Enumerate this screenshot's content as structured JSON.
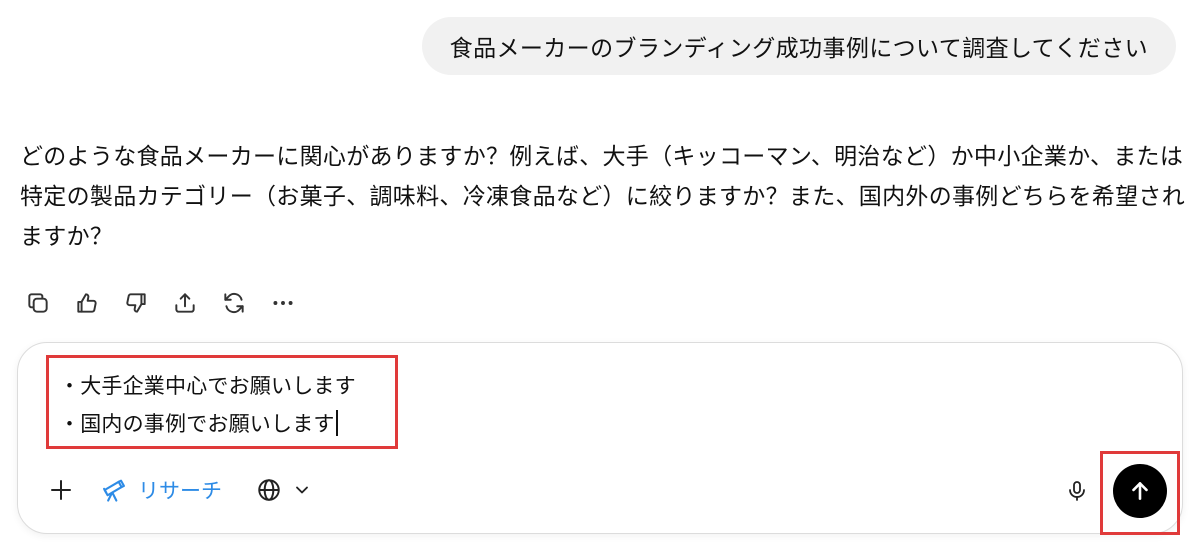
{
  "conversation": {
    "user_message": "食品メーカーのブランディング成功事例について調査してください",
    "assistant_message": "どのような食品メーカーに関心がありますか？例えば、大手（キッコーマン、明治など）か中小企業か、または特定の製品カテゴリー（お菓子、調味料、冷凍食品など）に絞りますか？また、国内外の事例どちらを希望されますか？"
  },
  "message_actions": [
    {
      "icon": "copy-icon"
    },
    {
      "icon": "thumbs-up-icon"
    },
    {
      "icon": "thumbs-down-icon"
    },
    {
      "icon": "share-icon"
    },
    {
      "icon": "regenerate-icon"
    },
    {
      "icon": "more-icon"
    }
  ],
  "composer": {
    "input_lines": [
      "・大手企業中心でお願いします",
      "・国内の事例でお願いします"
    ],
    "research_label": "リサーチ",
    "icons": {
      "add": "plus-icon",
      "research": "telescope-icon",
      "web": "globe-icon",
      "dropdown": "chevron-down-icon",
      "mic": "microphone-icon",
      "send": "arrow-up-icon"
    }
  },
  "colors": {
    "accent": "#2d8be6",
    "highlight": "#e03a3a",
    "user_bubble_bg": "#f1f1f1",
    "send_bg": "#000000"
  }
}
